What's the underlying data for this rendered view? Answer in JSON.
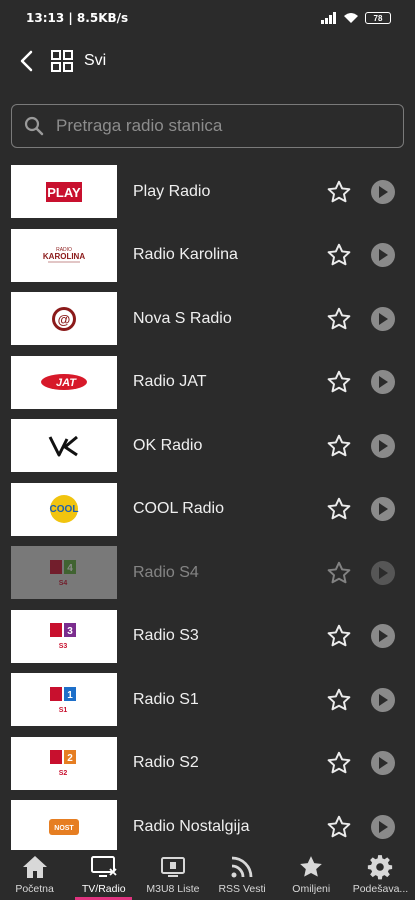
{
  "status": {
    "time": "13:13 | 8.5KB/s",
    "battery": "78"
  },
  "header": {
    "title": "Svi"
  },
  "search": {
    "placeholder": "Pretraga radio stanica"
  },
  "stations": [
    {
      "name": "Play Radio",
      "logo_text": "PLAY",
      "logo_color": "#c8102e"
    },
    {
      "name": "Radio Karolina",
      "logo_text": "KAROLINA",
      "logo_color": "#8b1a1a"
    },
    {
      "name": "Nova S Radio",
      "logo_text": "@",
      "logo_color": "#8b1a1a"
    },
    {
      "name": "Radio JAT",
      "logo_text": "JAT",
      "logo_color": "#d7192a"
    },
    {
      "name": "OK Radio",
      "logo_text": "OK",
      "logo_color": "#111111"
    },
    {
      "name": "COOL Radio",
      "logo_text": "COOL",
      "logo_color": "#f1c40f"
    },
    {
      "name": "Radio S4",
      "logo_text": "S4",
      "logo_color": "#5aa83a"
    },
    {
      "name": "Radio S3",
      "logo_text": "S3",
      "logo_color": "#7b2d8e"
    },
    {
      "name": "Radio S1",
      "logo_text": "S1",
      "logo_color": "#1d6fc9"
    },
    {
      "name": "Radio S2",
      "logo_text": "S2",
      "logo_color": "#e67e22"
    },
    {
      "name": "Radio Nostalgija",
      "logo_text": "NOST",
      "logo_color": "#e67e22"
    }
  ],
  "nav": [
    {
      "label": "Početna",
      "icon": "home-icon"
    },
    {
      "label": "TV/Radio",
      "icon": "tv-radio-icon",
      "active": true
    },
    {
      "label": "M3U8 Liste",
      "icon": "playlist-tv-icon"
    },
    {
      "label": "RSS Vesti",
      "icon": "rss-icon"
    },
    {
      "label": "Omiljeni",
      "icon": "star-icon"
    },
    {
      "label": "Podešava...",
      "icon": "gear-icon"
    }
  ],
  "colors": {
    "background": "#2b2b2b",
    "accent": "#e0337f",
    "text": "#efefef"
  }
}
